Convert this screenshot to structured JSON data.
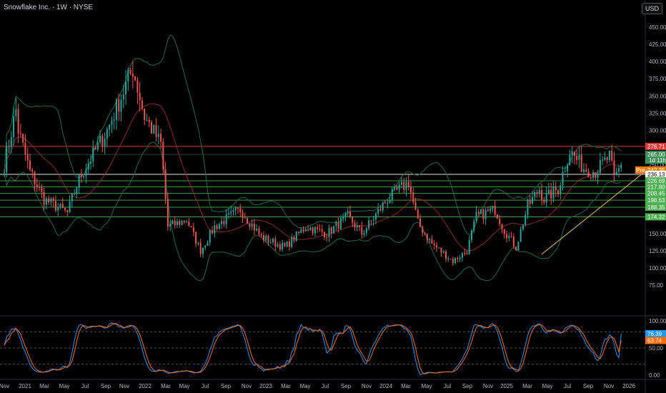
{
  "header": {
    "title": "Snowflake Inc. · 1W · NYSE",
    "currency": "USD"
  },
  "chart_data": [
    {
      "type": "candlestick",
      "title": "Snowflake Inc. · 1W · NYSE",
      "ylim": [
        62,
        462
      ],
      "yticks": [
        "450.00",
        "425.00",
        "400.00",
        "375.00",
        "350.00",
        "325.00",
        "300.00",
        "275.00",
        "250.00",
        "225.00",
        "200.00",
        "175.00",
        "150.00",
        "125.00",
        "100.00",
        "75.00"
      ],
      "xticks": [
        "Nov",
        "2021",
        "Mar",
        "May",
        "Jul",
        "Sep",
        "Nov",
        "2022",
        "Mar",
        "May",
        "Jul",
        "Sep",
        "Nov",
        "2023",
        "Mar",
        "May",
        "Jul",
        "Sep",
        "Nov",
        "2024",
        "Mar",
        "May",
        "Jul",
        "Sep",
        "Nov",
        "2025",
        "Mar",
        "May",
        "Jul",
        "Sep",
        "Nov",
        "2026"
      ],
      "price_path_weeks": [
        0,
        5,
        6,
        11,
        17,
        27,
        32,
        44,
        55,
        60,
        67,
        70,
        78,
        84,
        90,
        101,
        110,
        120,
        129,
        138,
        147,
        153,
        164,
        173,
        177,
        180,
        183,
        192,
        198,
        202,
        210,
        214,
        219,
        224,
        229,
        231,
        237,
        242,
        248,
        253,
        259,
        261,
        264
      ],
      "price_path_close": [
        250,
        330,
        300,
        240,
        200,
        180,
        230,
        300,
        390,
        320,
        280,
        160,
        170,
        125,
        160,
        185,
        145,
        130,
        160,
        150,
        175,
        150,
        200,
        225,
        165,
        150,
        135,
        110,
        125,
        175,
        185,
        155,
        130,
        190,
        215,
        200,
        215,
        270,
        245,
        240,
        262,
        230,
        250
      ],
      "indicators": [
        "Bollinger Bands (20)",
        "Stochastic"
      ],
      "levels": [
        {
          "label": "276.71",
          "value": 276.71,
          "color": "#e53935"
        },
        {
          "label": "265.00",
          "value": 265.0,
          "color": "#3f8f5a",
          "sub": "1d 11h"
        },
        {
          "label": "242.35",
          "value": 242.35,
          "color": "#f57c00",
          "tag": "Pre"
        },
        {
          "label": "236.13",
          "value": 236.13,
          "color": "#ffffff"
        },
        {
          "label": "226.69",
          "value": 226.69,
          "color": "#4caf50"
        },
        {
          "label": "217.80",
          "value": 217.8,
          "color": "#4caf50"
        },
        {
          "label": "208.45",
          "value": 208.45,
          "color": "#4caf50"
        },
        {
          "label": "198.63",
          "value": 198.63,
          "color": "#4caf50"
        },
        {
          "label": "188.35",
          "value": 188.35,
          "color": "#4caf50"
        },
        {
          "label": "174.32",
          "value": 174.32,
          "color": "#4caf50"
        }
      ],
      "trendline": {
        "from_week": 230,
        "from_price": 120,
        "to_week": 276,
        "to_price": 245,
        "color": "#e6c65a"
      }
    },
    {
      "type": "line",
      "title": "Stochastic",
      "ylim": [
        0,
        100
      ],
      "yticks": [
        "100.00",
        "50.00",
        "0.00"
      ],
      "bands": [
        80,
        50,
        20
      ],
      "series": [
        {
          "name": "%K",
          "color": "#2196f3",
          "last": "76.39"
        },
        {
          "name": "%D",
          "color": "#ff6d00",
          "last": "63.74"
        }
      ]
    }
  ],
  "colors": {
    "up": "#26a69a",
    "down": "#ef5350",
    "bb": "#1e6b4e",
    "basis": "#8b2b2b"
  }
}
